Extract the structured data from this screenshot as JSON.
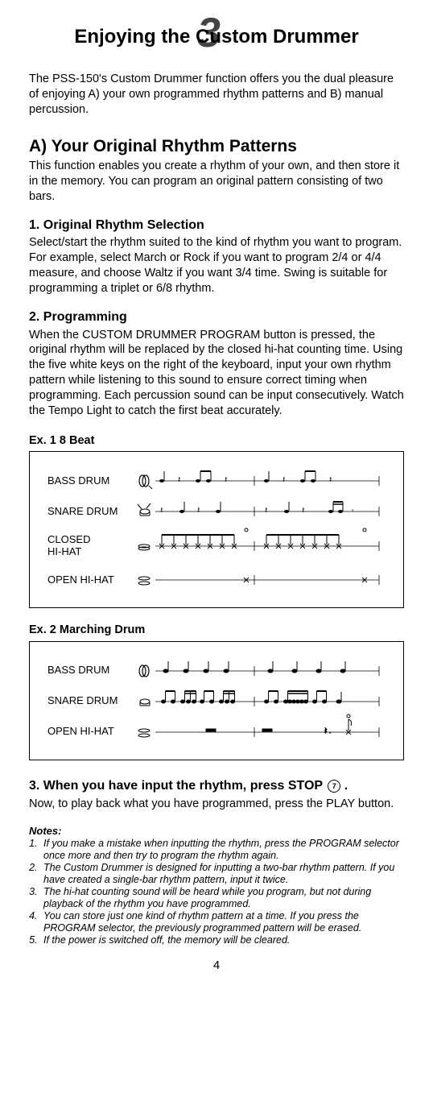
{
  "chapter_number": "3",
  "title": "Enjoying the Custom Drummer",
  "intro": "The PSS-150's Custom Drummer function offers you the dual pleasure of enjoying A) your own programmed rhythm patterns and B) manual percussion.",
  "section_a": {
    "heading": "A) Your Original Rhythm Patterns",
    "body": "This function enables you create a rhythm of your own, and then store it in the memory. You can program an original pattern consisting of two bars."
  },
  "sub1": {
    "heading": "1. Original Rhythm Selection",
    "body": "Select/start the rhythm suited to the kind of rhythm you want to program. For example, select March or Rock if you want to program 2/4 or 4/4 measure, and choose Waltz if you want 3/4 time. Swing is suitable for programming a triplet or 6/8 rhythm."
  },
  "sub2": {
    "heading": "2. Programming",
    "body": "When the CUSTOM DRUMMER PROGRAM button is pressed, the original rhythm will be replaced by the closed hi-hat counting time. Using the five white keys on the right of the keyboard, input your own rhythm pattern while listening to this sound to ensure correct timing when programming. Each percussion sound can be input consecutively. Watch the Tempo Light to catch the first beat accurately."
  },
  "ex1": {
    "label": "Ex. 1    8 Beat",
    "rows": [
      "BASS DRUM",
      "SNARE DRUM",
      "CLOSED HI-HAT",
      "OPEN HI-HAT"
    ]
  },
  "ex2": {
    "label": "Ex. 2    Marching Drum",
    "rows": [
      "BASS DRUM",
      "SNARE DRUM",
      "OPEN HI-HAT"
    ]
  },
  "sub3": {
    "heading_a": "3. When you have input the rhythm, press STOP ",
    "heading_b": " .",
    "stop_num": "7",
    "body": "Now, to play back what you have programmed, press the PLAY button."
  },
  "notes_heading": "Notes:",
  "notes": [
    "If you make a mistake when inputting the rhythm, press the PROGRAM selector once more and then try to program the rhythm again.",
    "The Custom Drummer is designed for inputting a two-bar rhythm pattern. If you have created a single-bar rhythm pattern, input it twice.",
    "The hi-hat counting sound will be heard while you program, but not during playback of the rhythm you have programmed.",
    "You can store just one kind of rhythm pattern at a time. If you press the PROGRAM selector, the previously programmed pattern will be erased.",
    "If the power is switched off, the memory will be cleared."
  ],
  "page_number": "4"
}
